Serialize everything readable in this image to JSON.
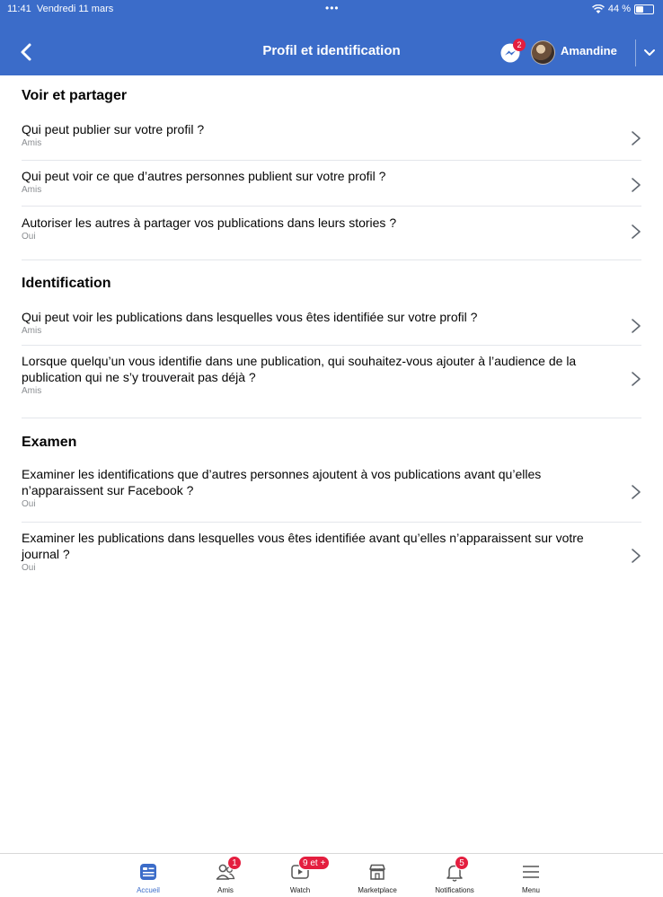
{
  "status_bar": {
    "time": "11:41",
    "date": "Vendredi 11 mars",
    "dots": "•••",
    "battery": "44 %",
    "battery_level": 0.44
  },
  "header": {
    "title": "Profil et identification",
    "messenger_badge": "2",
    "user_name": "Amandine"
  },
  "sections": [
    {
      "title": "Voir et partager",
      "rows": [
        {
          "title": "Qui peut publier sur votre profil ?",
          "value": "Amis"
        },
        {
          "title": "Qui peut voir ce que d’autres personnes publient sur votre profil ?",
          "value": "Amis"
        },
        {
          "title": "Autoriser les autres à partager vos publications dans leurs stories ?",
          "value": "Oui"
        }
      ]
    },
    {
      "title": "Identification",
      "rows": [
        {
          "title": "Qui peut voir les publications dans lesquelles vous êtes identifiée sur votre profil ?",
          "value": "Amis"
        },
        {
          "title": "Lorsque quelqu’un vous identifie dans une publication, qui souhaitez-vous ajouter à l’audience de la publication qui ne s’y trouverait pas déjà ?",
          "value": "Amis"
        }
      ]
    },
    {
      "title": "Examen",
      "rows": [
        {
          "title": "Examiner les identifications que d’autres personnes ajoutent à vos publications avant qu’elles n’apparaissent sur Facebook ?",
          "value": "Oui"
        },
        {
          "title": "Examiner les publications dans lesquelles vous êtes identifiée avant qu’elles n’apparaissent sur votre journal ?",
          "value": "Oui"
        }
      ]
    }
  ],
  "tabbar": {
    "tabs": [
      {
        "label": "Accueil",
        "icon": "home-feed-icon",
        "active": true
      },
      {
        "label": "Amis",
        "icon": "friends-icon",
        "badge": "1"
      },
      {
        "label": "Watch",
        "icon": "watch-video-icon",
        "badge": "9 et +"
      },
      {
        "label": "Marketplace",
        "icon": "marketplace-shop-icon"
      },
      {
        "label": "Notifications",
        "icon": "bell-icon",
        "badge": "5"
      },
      {
        "label": "Menu",
        "icon": "hamburger-menu-icon"
      }
    ]
  },
  "colors": {
    "header_bg": "#3b6cc9",
    "badge_red": "#e41e3f",
    "active_tab": "#3b6cc9"
  }
}
